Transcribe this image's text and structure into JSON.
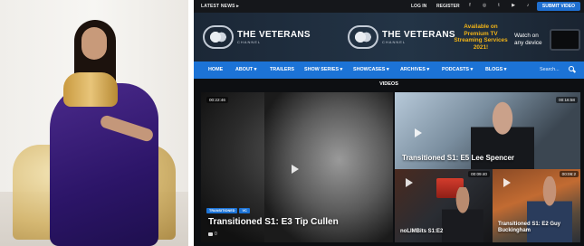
{
  "topbar": {
    "latest_news": "LATEST NEWS ▸",
    "login": "LOG IN",
    "register": "REGISTER",
    "social": [
      "f",
      "◎",
      "t",
      "▶",
      "♪",
      "◎",
      "♟"
    ],
    "submit": "SUBMIT VIDEO"
  },
  "header": {
    "logo_text": "THE VETERANS",
    "logo_subtext": "CHANNEL",
    "promo_premium": "Available on Premium TV Streaming Services 2021!",
    "promo_watch": "Watch on any device"
  },
  "nav": {
    "items": [
      "HOME",
      "ABOUT ▾",
      "TRAILERS",
      "SHOW SERIES ▾",
      "SHOWCASES ▾",
      "ARCHIVES ▾",
      "PODCASTS ▾",
      "BLOGS ▾"
    ],
    "search_placeholder": "Search..."
  },
  "section_title": "VIDEOS",
  "videos": [
    {
      "duration": "00:22:46",
      "title": "Transitioned S1: E3 Tip Cullen",
      "tags": [
        "TRANSITIONED",
        "VC"
      ],
      "comments": "0"
    },
    {
      "duration": "00:16:58",
      "title": "Transitioned S1: E5 Lee Spencer"
    },
    {
      "duration": "00:09:40",
      "title": "noLIMBits S1:E2"
    },
    {
      "duration": "00:06:2",
      "title": "Transitioned S1: E2 Guy Buckingham"
    }
  ],
  "colors": {
    "nav": "#1c73d6",
    "promo": "#f1b317",
    "background": "#0d0f12"
  }
}
